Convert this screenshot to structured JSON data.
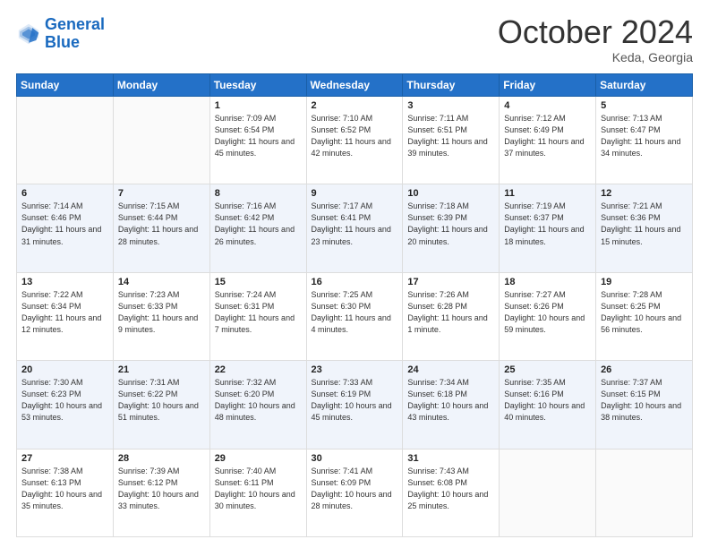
{
  "header": {
    "logo_line1": "General",
    "logo_line2": "Blue",
    "month": "October 2024",
    "location": "Keda, Georgia"
  },
  "weekdays": [
    "Sunday",
    "Monday",
    "Tuesday",
    "Wednesday",
    "Thursday",
    "Friday",
    "Saturday"
  ],
  "weeks": [
    [
      {
        "day": "",
        "sunrise": "",
        "sunset": "",
        "daylight": ""
      },
      {
        "day": "",
        "sunrise": "",
        "sunset": "",
        "daylight": ""
      },
      {
        "day": "1",
        "sunrise": "Sunrise: 7:09 AM",
        "sunset": "Sunset: 6:54 PM",
        "daylight": "Daylight: 11 hours and 45 minutes."
      },
      {
        "day": "2",
        "sunrise": "Sunrise: 7:10 AM",
        "sunset": "Sunset: 6:52 PM",
        "daylight": "Daylight: 11 hours and 42 minutes."
      },
      {
        "day": "3",
        "sunrise": "Sunrise: 7:11 AM",
        "sunset": "Sunset: 6:51 PM",
        "daylight": "Daylight: 11 hours and 39 minutes."
      },
      {
        "day": "4",
        "sunrise": "Sunrise: 7:12 AM",
        "sunset": "Sunset: 6:49 PM",
        "daylight": "Daylight: 11 hours and 37 minutes."
      },
      {
        "day": "5",
        "sunrise": "Sunrise: 7:13 AM",
        "sunset": "Sunset: 6:47 PM",
        "daylight": "Daylight: 11 hours and 34 minutes."
      }
    ],
    [
      {
        "day": "6",
        "sunrise": "Sunrise: 7:14 AM",
        "sunset": "Sunset: 6:46 PM",
        "daylight": "Daylight: 11 hours and 31 minutes."
      },
      {
        "day": "7",
        "sunrise": "Sunrise: 7:15 AM",
        "sunset": "Sunset: 6:44 PM",
        "daylight": "Daylight: 11 hours and 28 minutes."
      },
      {
        "day": "8",
        "sunrise": "Sunrise: 7:16 AM",
        "sunset": "Sunset: 6:42 PM",
        "daylight": "Daylight: 11 hours and 26 minutes."
      },
      {
        "day": "9",
        "sunrise": "Sunrise: 7:17 AM",
        "sunset": "Sunset: 6:41 PM",
        "daylight": "Daylight: 11 hours and 23 minutes."
      },
      {
        "day": "10",
        "sunrise": "Sunrise: 7:18 AM",
        "sunset": "Sunset: 6:39 PM",
        "daylight": "Daylight: 11 hours and 20 minutes."
      },
      {
        "day": "11",
        "sunrise": "Sunrise: 7:19 AM",
        "sunset": "Sunset: 6:37 PM",
        "daylight": "Daylight: 11 hours and 18 minutes."
      },
      {
        "day": "12",
        "sunrise": "Sunrise: 7:21 AM",
        "sunset": "Sunset: 6:36 PM",
        "daylight": "Daylight: 11 hours and 15 minutes."
      }
    ],
    [
      {
        "day": "13",
        "sunrise": "Sunrise: 7:22 AM",
        "sunset": "Sunset: 6:34 PM",
        "daylight": "Daylight: 11 hours and 12 minutes."
      },
      {
        "day": "14",
        "sunrise": "Sunrise: 7:23 AM",
        "sunset": "Sunset: 6:33 PM",
        "daylight": "Daylight: 11 hours and 9 minutes."
      },
      {
        "day": "15",
        "sunrise": "Sunrise: 7:24 AM",
        "sunset": "Sunset: 6:31 PM",
        "daylight": "Daylight: 11 hours and 7 minutes."
      },
      {
        "day": "16",
        "sunrise": "Sunrise: 7:25 AM",
        "sunset": "Sunset: 6:30 PM",
        "daylight": "Daylight: 11 hours and 4 minutes."
      },
      {
        "day": "17",
        "sunrise": "Sunrise: 7:26 AM",
        "sunset": "Sunset: 6:28 PM",
        "daylight": "Daylight: 11 hours and 1 minute."
      },
      {
        "day": "18",
        "sunrise": "Sunrise: 7:27 AM",
        "sunset": "Sunset: 6:26 PM",
        "daylight": "Daylight: 10 hours and 59 minutes."
      },
      {
        "day": "19",
        "sunrise": "Sunrise: 7:28 AM",
        "sunset": "Sunset: 6:25 PM",
        "daylight": "Daylight: 10 hours and 56 minutes."
      }
    ],
    [
      {
        "day": "20",
        "sunrise": "Sunrise: 7:30 AM",
        "sunset": "Sunset: 6:23 PM",
        "daylight": "Daylight: 10 hours and 53 minutes."
      },
      {
        "day": "21",
        "sunrise": "Sunrise: 7:31 AM",
        "sunset": "Sunset: 6:22 PM",
        "daylight": "Daylight: 10 hours and 51 minutes."
      },
      {
        "day": "22",
        "sunrise": "Sunrise: 7:32 AM",
        "sunset": "Sunset: 6:20 PM",
        "daylight": "Daylight: 10 hours and 48 minutes."
      },
      {
        "day": "23",
        "sunrise": "Sunrise: 7:33 AM",
        "sunset": "Sunset: 6:19 PM",
        "daylight": "Daylight: 10 hours and 45 minutes."
      },
      {
        "day": "24",
        "sunrise": "Sunrise: 7:34 AM",
        "sunset": "Sunset: 6:18 PM",
        "daylight": "Daylight: 10 hours and 43 minutes."
      },
      {
        "day": "25",
        "sunrise": "Sunrise: 7:35 AM",
        "sunset": "Sunset: 6:16 PM",
        "daylight": "Daylight: 10 hours and 40 minutes."
      },
      {
        "day": "26",
        "sunrise": "Sunrise: 7:37 AM",
        "sunset": "Sunset: 6:15 PM",
        "daylight": "Daylight: 10 hours and 38 minutes."
      }
    ],
    [
      {
        "day": "27",
        "sunrise": "Sunrise: 7:38 AM",
        "sunset": "Sunset: 6:13 PM",
        "daylight": "Daylight: 10 hours and 35 minutes."
      },
      {
        "day": "28",
        "sunrise": "Sunrise: 7:39 AM",
        "sunset": "Sunset: 6:12 PM",
        "daylight": "Daylight: 10 hours and 33 minutes."
      },
      {
        "day": "29",
        "sunrise": "Sunrise: 7:40 AM",
        "sunset": "Sunset: 6:11 PM",
        "daylight": "Daylight: 10 hours and 30 minutes."
      },
      {
        "day": "30",
        "sunrise": "Sunrise: 7:41 AM",
        "sunset": "Sunset: 6:09 PM",
        "daylight": "Daylight: 10 hours and 28 minutes."
      },
      {
        "day": "31",
        "sunrise": "Sunrise: 7:43 AM",
        "sunset": "Sunset: 6:08 PM",
        "daylight": "Daylight: 10 hours and 25 minutes."
      },
      {
        "day": "",
        "sunrise": "",
        "sunset": "",
        "daylight": ""
      },
      {
        "day": "",
        "sunrise": "",
        "sunset": "",
        "daylight": ""
      }
    ]
  ]
}
